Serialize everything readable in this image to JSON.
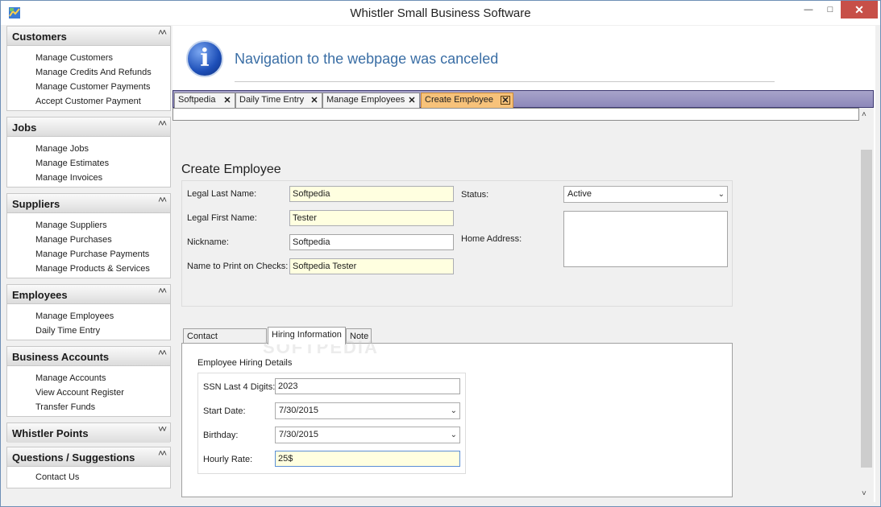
{
  "window": {
    "title": "Whistler Small  Business Software",
    "min_label": "—",
    "max_label": "□",
    "close_label": "✕"
  },
  "sidebar": {
    "groups": [
      {
        "title": "Customers",
        "chevron": "˄˄",
        "items": [
          "Manage Customers",
          "Manage Credits And Refunds",
          "Manage Customer Payments",
          "Accept Customer Payment"
        ]
      },
      {
        "title": "Jobs",
        "chevron": "˄˄",
        "items": [
          "Manage Jobs",
          "Manage Estimates",
          "Manage Invoices"
        ]
      },
      {
        "title": "Suppliers",
        "chevron": "˄˄",
        "items": [
          "Manage Suppliers",
          "Manage Purchases",
          "Manage Purchase Payments",
          "Manage Products & Services"
        ]
      },
      {
        "title": "Employees",
        "chevron": "˄˄",
        "items": [
          "Manage Employees",
          "Daily Time Entry"
        ]
      },
      {
        "title": "Business Accounts",
        "chevron": "˄˄",
        "items": [
          "Manage Accounts",
          "View Account Register",
          "Transfer Funds"
        ]
      },
      {
        "title": "Whistler Points",
        "chevron": "˅˅",
        "items": []
      },
      {
        "title": "Questions / Suggestions",
        "chevron": "˄˄",
        "items": [
          "Contact Us"
        ]
      }
    ]
  },
  "browser": {
    "info_glyph": "i",
    "message": "Navigation to the webpage was canceled"
  },
  "tabs": [
    {
      "label": "Softpedia",
      "close": "✕"
    },
    {
      "label": "Daily Time Entry",
      "close": "✕"
    },
    {
      "label": "Manage Employees",
      "close": "✕"
    },
    {
      "label": "Create Employee",
      "close": "✕",
      "active": true
    }
  ],
  "form": {
    "title": "Create Employee",
    "legal_last_name": {
      "label": "Legal Last Name:",
      "value": "Softpedia"
    },
    "legal_first_name": {
      "label": "Legal First Name:",
      "value": "Tester"
    },
    "nickname": {
      "label": "Nickname:",
      "value": "Softpedia"
    },
    "check_name": {
      "label": "Name to Print on Checks:",
      "value": "Softpedia Tester"
    },
    "status": {
      "label": "Status:",
      "value": "Active",
      "arrow": "⌄"
    },
    "home_address": {
      "label": "Home Address:",
      "value": ""
    }
  },
  "inner_tabs": [
    {
      "label": "Contact Information"
    },
    {
      "label": "Hiring Information",
      "active": true
    },
    {
      "label": "Note"
    }
  ],
  "hiring": {
    "group_title": "Employee Hiring Details",
    "watermark": "SOFTPEDIA",
    "ssn": {
      "label": "SSN Last 4 Digits:",
      "value": "2023"
    },
    "start_date": {
      "label": "Start Date:",
      "value": "7/30/2015",
      "arrow": "⌄"
    },
    "birthday": {
      "label": "Birthday:",
      "value": "7/30/2015",
      "arrow": "⌄"
    },
    "hourly_rate": {
      "label": "Hourly Rate:",
      "value": "25$"
    }
  },
  "scrollbar": {
    "up": "˄",
    "down": "˅"
  }
}
